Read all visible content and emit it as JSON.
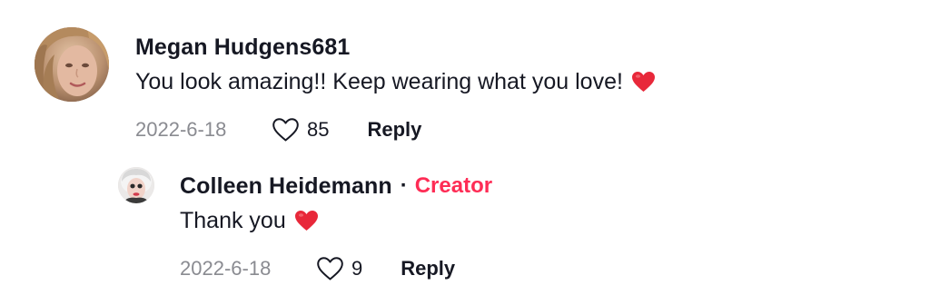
{
  "comments": [
    {
      "username": "Megan Hudgens681",
      "text": "You look amazing!! Keep wearing what you love!",
      "emoji": "red-heart-emoji",
      "date": "2022-6-18",
      "likes": "85",
      "reply_label": "Reply",
      "avatar": "user-avatar-photo"
    }
  ],
  "reply": {
    "username": "Colleen Heidemann",
    "separator": "·",
    "badge": "Creator",
    "text": "Thank you",
    "emoji": "red-heart-emoji",
    "date": "2022-6-18",
    "likes": "9",
    "reply_label": "Reply",
    "avatar": "creator-avatar-photo"
  },
  "colors": {
    "text": "#161823",
    "muted": "#8a8b91",
    "creator_badge": "#fe2c55",
    "heart_emoji": "#e8283a",
    "like_icon_stroke": "#161823"
  },
  "icons": {
    "like": "heart-outline-icon",
    "emoji": "red-heart-emoji"
  }
}
